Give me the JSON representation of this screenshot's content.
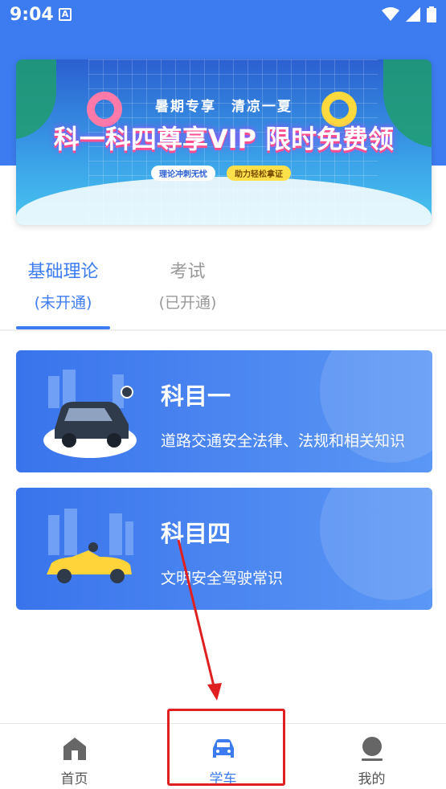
{
  "status_bar": {
    "time": "9:04",
    "notification_letter": "A"
  },
  "banner": {
    "subtitle": "暑期专享　清凉一夏",
    "headline": "科一科四尊享VIP 限时免费领",
    "pill_left": "理论冲刺无忧",
    "pill_right": "助力轻松拿证"
  },
  "tabs": [
    {
      "label": "基础理论",
      "status": "(未开通)",
      "active": true
    },
    {
      "label": "考试",
      "status": "(已开通)",
      "active": false
    }
  ],
  "courses": [
    {
      "title": "科目一",
      "description": "道路交通安全法律、法规和相关知识",
      "icon": "car-illustration-icon"
    },
    {
      "title": "科目四",
      "description": "文明安全驾驶常识",
      "icon": "convertible-illustration-icon"
    }
  ],
  "bottom_nav": [
    {
      "label": "首页",
      "icon": "home-icon",
      "active": false
    },
    {
      "label": "学车",
      "icon": "car-icon",
      "active": true
    },
    {
      "label": "我的",
      "icon": "profile-icon",
      "active": false
    }
  ],
  "colors": {
    "primary": "#3d7cf0",
    "annotation_red": "#e02020",
    "inactive_text": "#999999"
  }
}
